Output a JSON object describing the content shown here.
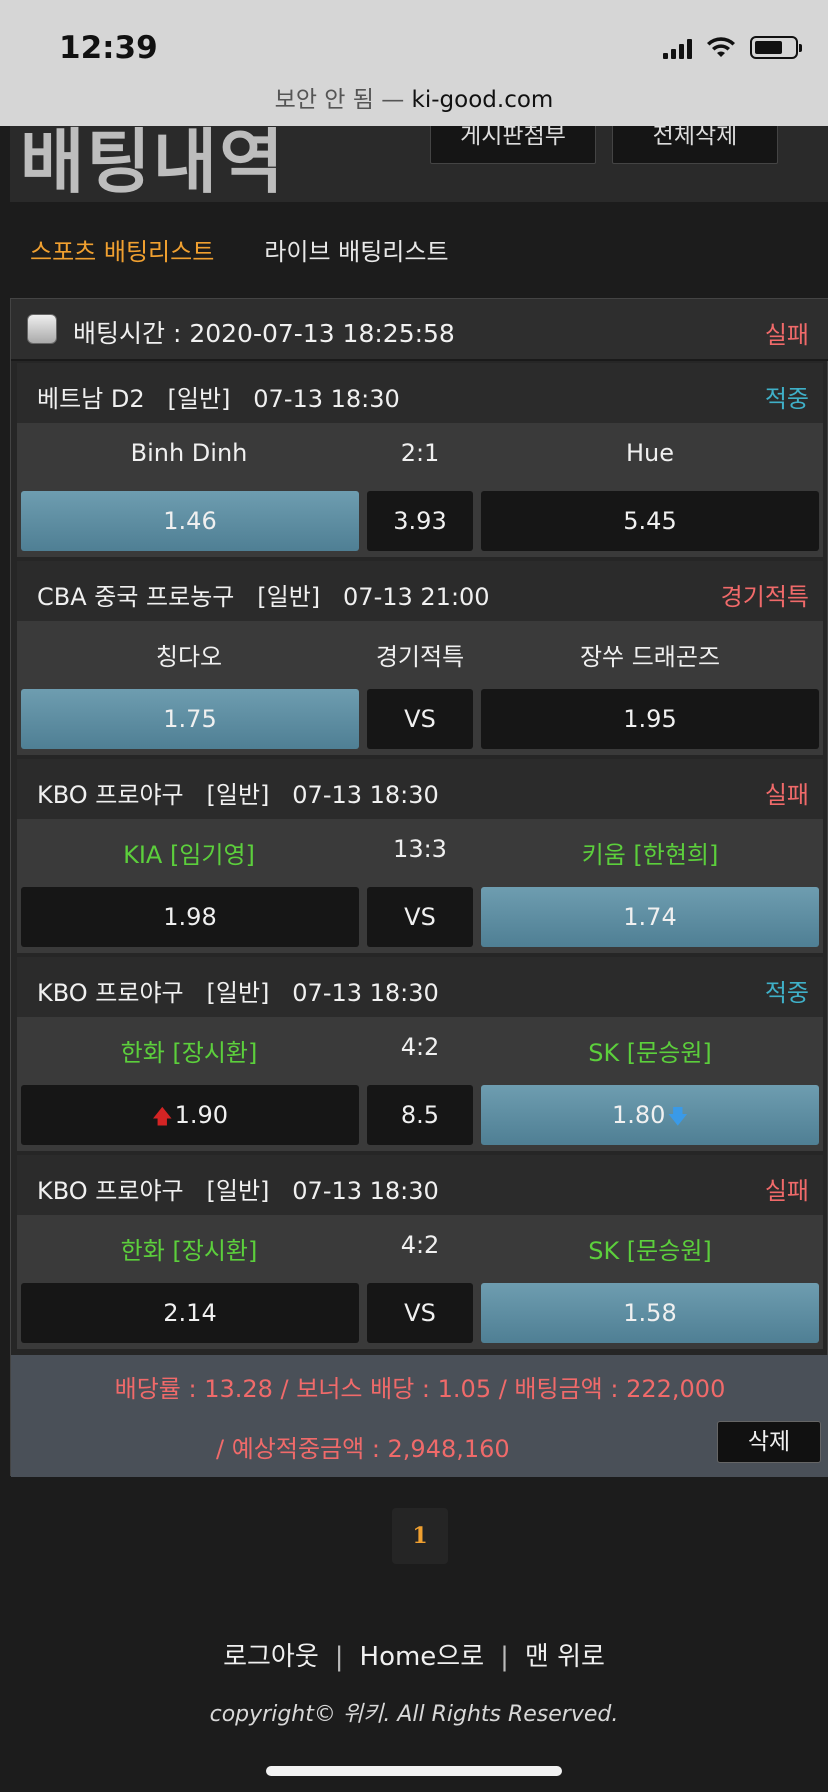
{
  "status_bar": {
    "time": "12:39"
  },
  "browser": {
    "url_prefix": "보안 안 됨 — ",
    "url_domain": "ki-good.com"
  },
  "header": {
    "title": "배팅내역",
    "board_button": "게시판첨부",
    "delete_all_button": "전체삭제"
  },
  "tabs": {
    "sports": "스포츠 배팅리스트",
    "live": "라이브 배팅리스트"
  },
  "bet": {
    "time_label": "배팅시간 : 2020-07-13 18:25:58",
    "status": "실패",
    "games": [
      {
        "league": "베트남 D2   [일반]   07-13 18:30",
        "status": "적중",
        "status_type": "win",
        "home": "Binh Dinh",
        "mid": "2:1",
        "away": "Hue",
        "odd_home": "1.46",
        "odd_mid": "3.93",
        "odd_away": "5.45",
        "selected": "home"
      },
      {
        "league": "CBA 중국 프로농구   [일반]   07-13 21:00",
        "status": "경기적특",
        "status_type": "fail",
        "home": "칭다오",
        "mid": "경기적특",
        "away": "장쑤 드래곤즈",
        "odd_home": "1.75",
        "odd_mid": "VS",
        "odd_away": "1.95",
        "selected": "home"
      },
      {
        "league": "KBO 프로야구   [일반]   07-13 18:30",
        "status": "실패",
        "status_type": "fail",
        "home": "KIA [임기영]",
        "mid": "13:3",
        "away": "키움 [한현희]",
        "odd_home": "1.98",
        "odd_mid": "VS",
        "odd_away": "1.74",
        "selected": "away"
      },
      {
        "league": "KBO 프로야구   [일반]   07-13 18:30",
        "status": "적중",
        "status_type": "win",
        "home": "한화 [장시환]",
        "mid": "4:2",
        "away": "SK [문승원]",
        "odd_home": "1.90",
        "odd_mid": "8.5",
        "odd_away": "1.80",
        "selected": "away"
      },
      {
        "league": "KBO 프로야구   [일반]   07-13 18:30",
        "status": "실패",
        "status_type": "fail",
        "home": "한화 [장시환]",
        "mid": "4:2",
        "away": "SK [문승원]",
        "odd_home": "2.14",
        "odd_mid": "VS",
        "odd_away": "1.58",
        "selected": "away"
      }
    ],
    "summary_line1": "배당률 : 13.28 / 보너스 배당 : 1.05 / 배팅금액 : 222,000",
    "summary_line2": "/ 예상적중금액 : 2,948,160",
    "delete_button": "삭제"
  },
  "pagination": {
    "current": "1"
  },
  "footer": {
    "logout": "로그아웃",
    "sep": "|",
    "home": "Home으로",
    "top": "맨 위로",
    "copyright": "copyright© 위키. All Rights Reserved."
  },
  "colors": {
    "fail": "#f06a6a",
    "win": "#3fb0c8",
    "team_green": "#5ccf3c",
    "tab_active": "#f0a030",
    "selected_odd": "#5f8ea2"
  }
}
